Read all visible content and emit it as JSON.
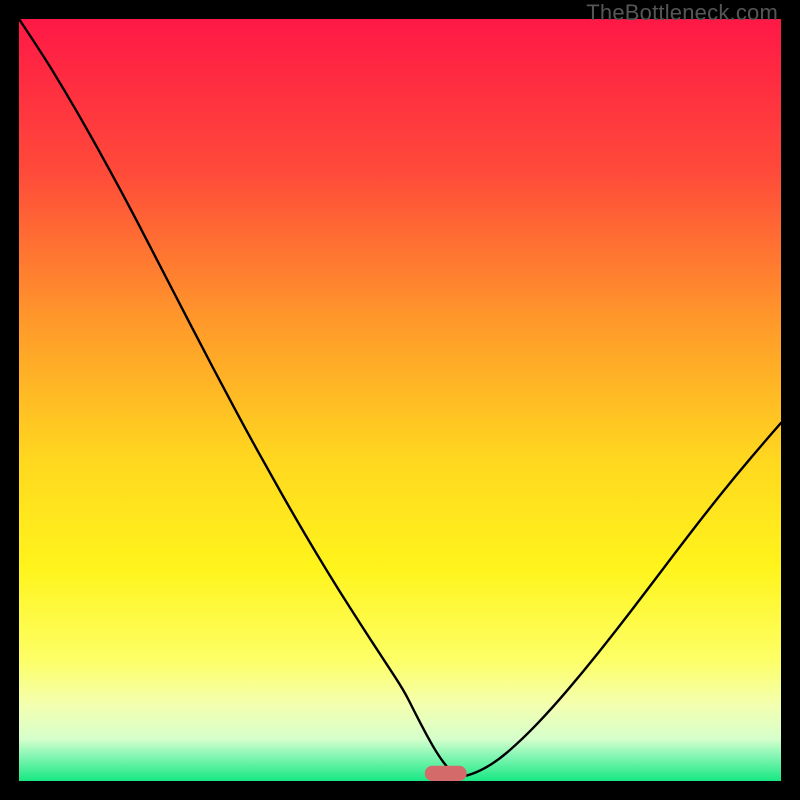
{
  "watermark": "TheBottleneck.com",
  "chart_data": {
    "type": "line",
    "title": "",
    "xlabel": "",
    "ylabel": "",
    "xlim": [
      0,
      100
    ],
    "ylim": [
      0,
      100
    ],
    "grid": false,
    "legend": false,
    "gradient_stops": [
      {
        "offset": 0.0,
        "color": "#ff1846"
      },
      {
        "offset": 0.2,
        "color": "#ff4a3a"
      },
      {
        "offset": 0.4,
        "color": "#ff9a2a"
      },
      {
        "offset": 0.58,
        "color": "#ffd81f"
      },
      {
        "offset": 0.72,
        "color": "#fff41c"
      },
      {
        "offset": 0.84,
        "color": "#fdff65"
      },
      {
        "offset": 0.9,
        "color": "#f4ffb0"
      },
      {
        "offset": 0.945,
        "color": "#d6ffcc"
      },
      {
        "offset": 0.965,
        "color": "#8cf7b6"
      },
      {
        "offset": 1.0,
        "color": "#18e884"
      }
    ],
    "series": [
      {
        "name": "bottleneck-curve",
        "stroke": "#000000",
        "stroke_width": 2.4,
        "x": [
          0,
          3,
          6,
          9,
          12,
          15,
          18,
          21,
          24,
          27,
          30,
          33,
          36,
          39,
          42,
          45,
          48,
          50.5,
          52,
          53.5,
          55,
          56.5,
          58,
          62,
          66,
          70,
          74,
          78,
          82,
          86,
          90,
          94,
          98,
          100
        ],
        "y": [
          100,
          95.5,
          90.6,
          85.4,
          80.0,
          74.4,
          68.6,
          62.8,
          57.0,
          51.3,
          45.7,
          40.3,
          35.0,
          29.9,
          25.0,
          20.3,
          15.7,
          11.9,
          8.9,
          6.0,
          3.4,
          1.4,
          0.3,
          2.0,
          5.4,
          9.6,
          14.3,
          19.3,
          24.5,
          29.8,
          35.0,
          40.0,
          44.7,
          47.0
        ]
      }
    ],
    "marker": {
      "name": "optimal-marker",
      "x": 56,
      "y": 0,
      "width": 5.5,
      "height": 2.0,
      "rx": 1.0,
      "fill": "#d46a6a"
    }
  }
}
